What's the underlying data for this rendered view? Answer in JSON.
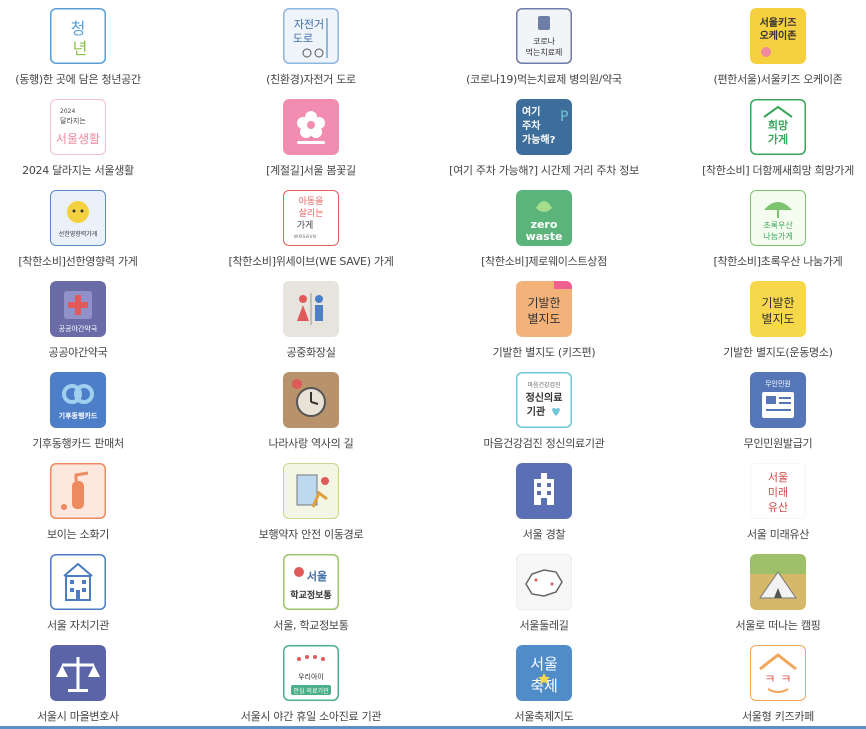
{
  "apps": [
    {
      "label": "(동행)한 곳에 담은 청년공간",
      "icon": "youth-space-icon",
      "color": "#5aa0d8",
      "icon_text": [
        "청",
        "년"
      ]
    },
    {
      "label": "(친환경)자전거 도로",
      "icon": "bicycle-road-icon",
      "color": "#8fb7dd",
      "icon_text": [
        "자전거",
        "도로"
      ]
    },
    {
      "label": "(코로나19)먹는치료제 병의원/약국",
      "icon": "covid-medicine-icon",
      "color": "#6d7ea8",
      "icon_text": [
        "코로나",
        "먹는치료제"
      ]
    },
    {
      "label": "(편한서울)서울키즈 오케이존",
      "icon": "kids-okzone-icon",
      "color": "#f5d040",
      "icon_text": [
        "서울키즈",
        "오케이존"
      ]
    },
    {
      "label": "2024 달라지는 서울생활",
      "icon": "seoul-life-2024-icon",
      "color": "#f08aa0",
      "icon_text": [
        "2024",
        "달라지는",
        "서울생활"
      ]
    },
    {
      "label": "[계절길]서울 봄꽃길",
      "icon": "spring-flower-icon",
      "color": "#f28cb1",
      "icon_text": []
    },
    {
      "label": "[여기 주차 가능해?] 시간제 거리 주차 정보",
      "icon": "parking-info-icon",
      "color": "#3d6e9b",
      "icon_text": [
        "여기",
        "주차",
        "가능해?"
      ]
    },
    {
      "label": "[착한소비] 더함께새희망 희망가게",
      "icon": "hope-store-icon",
      "color": "#3aa65a",
      "icon_text": [
        "희망",
        "가게"
      ]
    },
    {
      "label": "[착한소비]선한영향력 가게",
      "icon": "good-influence-icon",
      "color": "#5a8cc8",
      "icon_text": [
        "선한영향력가게"
      ]
    },
    {
      "label": "[착한소비]위세이브(WE SAVE) 가게",
      "icon": "we-save-icon",
      "color": "#e06060",
      "icon_text": [
        "아동을",
        "살리는",
        "가게",
        "wesave"
      ]
    },
    {
      "label": "[착한소비]제로웨이스트상점",
      "icon": "zero-waste-icon",
      "color": "#5bb47a",
      "icon_text": [
        "zero",
        "waste"
      ]
    },
    {
      "label": "[착한소비]초록우산 나눔가게",
      "icon": "green-umbrella-icon",
      "color": "#7cc56e",
      "icon_text": [
        "초록우산",
        "나눔가게"
      ]
    },
    {
      "label": "공공야간약국",
      "icon": "night-pharmacy-icon",
      "color": "#6a6ca8",
      "icon_text": [
        "공공야간약국"
      ]
    },
    {
      "label": "공중화장실",
      "icon": "public-restroom-icon",
      "color": "#d9d6cf",
      "icon_text": []
    },
    {
      "label": "기발한 별지도 (키즈편)",
      "icon": "star-map-kids-icon",
      "color": "#f3b27a",
      "icon_text": [
        "기발한",
        "별지도"
      ]
    },
    {
      "label": "기발한 별지도(운동명소)",
      "icon": "star-map-sports-icon",
      "color": "#f6d84a",
      "icon_text": [
        "기발한",
        "별지도"
      ]
    },
    {
      "label": "기후동행카드 판매처",
      "icon": "climate-card-icon",
      "color": "#4d7ec8",
      "icon_text": [
        "기후동행카드"
      ]
    },
    {
      "label": "나라사랑 역사의 길",
      "icon": "history-road-icon",
      "color": "#b8926a",
      "icon_text": []
    },
    {
      "label": "마음건강검진 정신의료기관",
      "icon": "mental-health-icon",
      "color": "#6fc6d8",
      "icon_text": [
        "마음건강검진",
        "정신의료",
        "기관"
      ]
    },
    {
      "label": "무인민원발급기",
      "icon": "kiosk-icon",
      "color": "#5577b8",
      "icon_text": [
        "무인민원"
      ]
    },
    {
      "label": "보이는 소화기",
      "icon": "fire-extinguisher-icon",
      "color": "#ee8a60",
      "icon_text": []
    },
    {
      "label": "보행약자 안전 이동경로",
      "icon": "safe-route-icon",
      "color": "#c9d98a",
      "icon_text": []
    },
    {
      "label": "서울 경찰",
      "icon": "police-icon",
      "color": "#5b6fb4",
      "icon_text": []
    },
    {
      "label": "서울 미래유산",
      "icon": "future-heritage-icon",
      "color": "#d24848",
      "icon_text": [
        "서울",
        "미래",
        "유산"
      ]
    },
    {
      "label": "서울 자치기관",
      "icon": "city-hall-icon",
      "color": "#4c7dc4",
      "icon_text": []
    },
    {
      "label": "서울, 학교정보통",
      "icon": "school-info-icon",
      "color": "#9cc46a",
      "icon_text": [
        "서울",
        "학교정보통"
      ]
    },
    {
      "label": "서울둘레길",
      "icon": "trail-map-icon",
      "color": "#e9e9e9",
      "icon_text": []
    },
    {
      "label": "서울로 떠나는 캠핑",
      "icon": "camping-icon",
      "color": "#d6b86a",
      "icon_text": []
    },
    {
      "label": "서울시 마을변호사",
      "icon": "village-lawyer-icon",
      "color": "#5c64a8",
      "icon_text": []
    },
    {
      "label": "서울시 야간 휴일 소아진료 기관",
      "icon": "pediatric-clinic-icon",
      "color": "#4bb08a",
      "icon_text": [
        "우리아이",
        "안심 의료기관"
      ]
    },
    {
      "label": "서울축제지도",
      "icon": "festival-map-icon",
      "color": "#4f8cc8",
      "icon_text": [
        "서울",
        "축제"
      ]
    },
    {
      "label": "서울형 키즈카페",
      "icon": "kids-cafe-icon",
      "color": "#f2a65a",
      "icon_text": [
        "ㅋ",
        "ㅋ"
      ]
    }
  ]
}
